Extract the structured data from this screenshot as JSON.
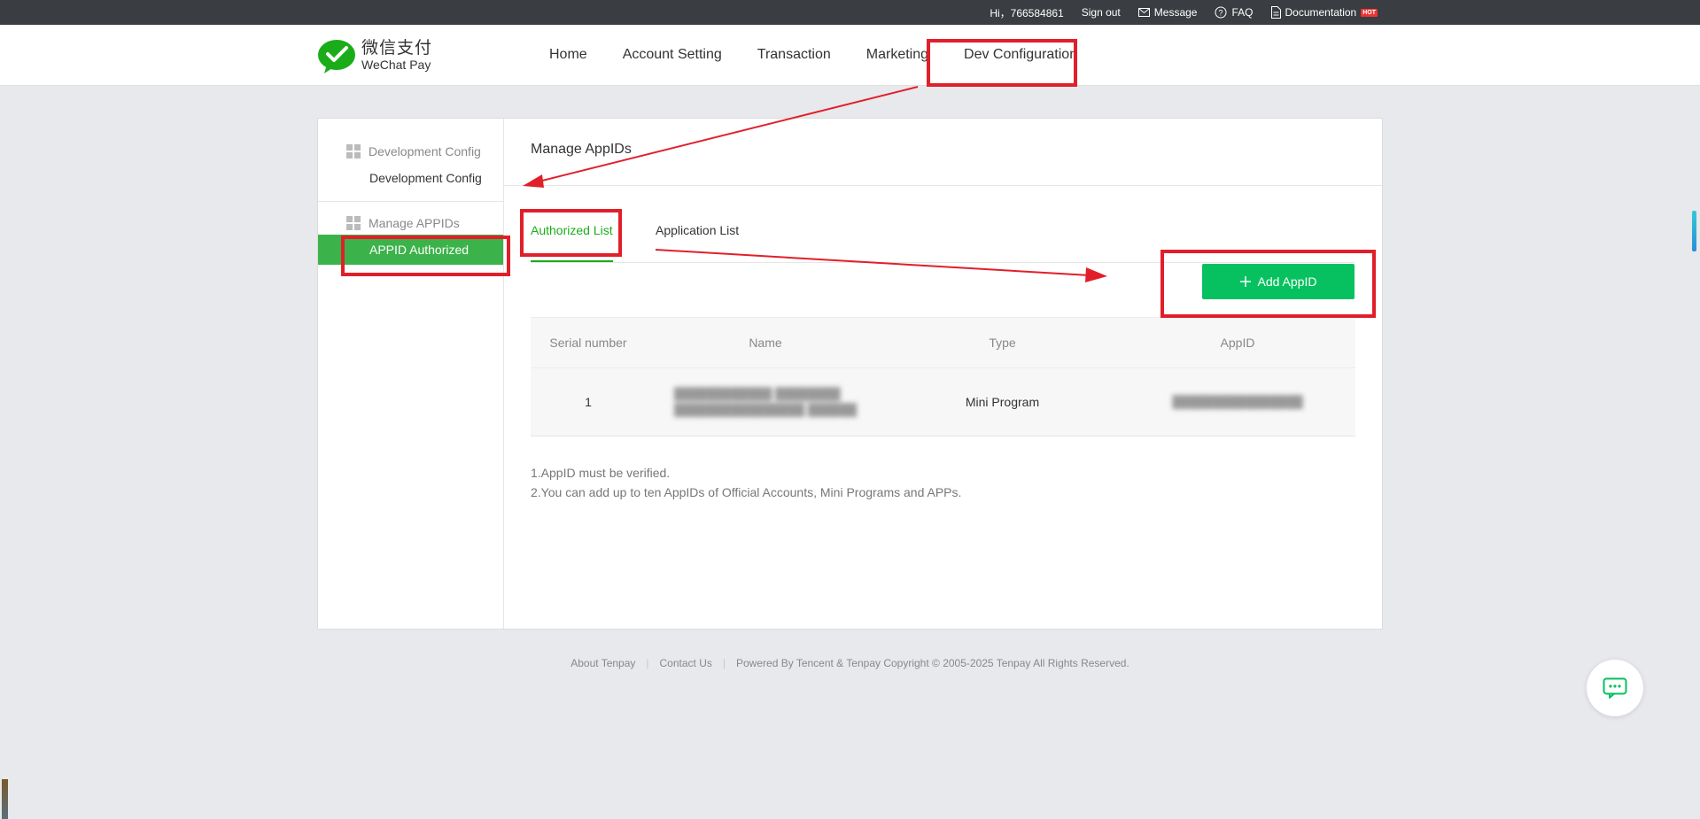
{
  "topbar": {
    "greeting": "Hi，766584861",
    "sign_out": "Sign out",
    "message": "Message",
    "faq": "FAQ",
    "documentation": "Documentation",
    "hot_badge": "HOT"
  },
  "header": {
    "logo_cn": "微信支付",
    "logo_en": "WeChat Pay",
    "nav": [
      {
        "label": "Home"
      },
      {
        "label": "Account Setting"
      },
      {
        "label": "Transaction"
      },
      {
        "label": "Marketing"
      },
      {
        "label": "Dev Configuration"
      }
    ]
  },
  "sidebar": {
    "groups": [
      {
        "title": "Development Config",
        "items": [
          {
            "label": "Development Config",
            "active": false
          }
        ]
      },
      {
        "title": "Manage APPIDs",
        "items": [
          {
            "label": "APPID Authorized",
            "active": true
          }
        ]
      }
    ]
  },
  "content": {
    "title": "Manage AppIDs",
    "tabs": [
      {
        "label": "Authorized List",
        "active": true
      },
      {
        "label": "Application List",
        "active": false
      }
    ],
    "add_button": "Add AppID",
    "table": {
      "headers": [
        "Serial number",
        "Name",
        "Type",
        "AppID"
      ],
      "rows": [
        {
          "serial": "1",
          "name_line1": "████████████ ████████",
          "name_line2": "████████████████ ██████",
          "type": "Mini Program",
          "appid": "████████████████"
        }
      ]
    },
    "notes": [
      "1.AppID must be verified.",
      "2.You can add up to ten AppIDs of Official Accounts, Mini Programs and APPs."
    ]
  },
  "footer": {
    "about": "About Tenpay",
    "contact": "Contact Us",
    "copyright": "Powered By Tencent & Tenpay Copyright © 2005-2025 Tenpay All Rights Reserved."
  },
  "colors": {
    "accent_green": "#07c160",
    "sidebar_active": "#3cb34a",
    "annotation_red": "#e11f2a",
    "topbar_bg": "#3a3d42"
  },
  "icons": {
    "message": "envelope-icon",
    "faq": "question-circle-icon",
    "documentation": "document-icon",
    "add": "plus-icon",
    "chat": "chat-bubble-icon",
    "sidebar_group": "grid-icon"
  }
}
